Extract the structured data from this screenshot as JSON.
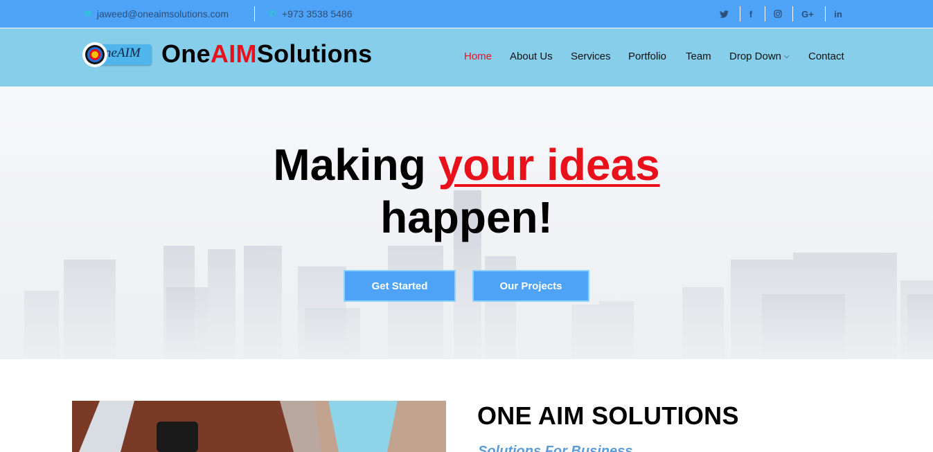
{
  "topbar": {
    "email": "jaweed@oneaimsolutions.com",
    "email_icon": "envelope-icon",
    "phone": "+973 3538 5486",
    "phone_icon": "phone-icon",
    "social": [
      {
        "name": "twitter-icon",
        "glyph": "🐦"
      },
      {
        "name": "facebook-icon",
        "glyph": "f"
      },
      {
        "name": "instagram-icon",
        "glyph": "◎"
      },
      {
        "name": "google-plus-icon",
        "glyph": "G+"
      },
      {
        "name": "linkedin-icon",
        "glyph": "in"
      }
    ]
  },
  "header": {
    "logo_text": "neAIM",
    "brand_part1": "One",
    "brand_part2": "AIM",
    "brand_part3": "Solutions",
    "nav": [
      {
        "label": "Home",
        "active": true
      },
      {
        "label": "About Us"
      },
      {
        "label": "Services"
      },
      {
        "label": "Portfolio"
      },
      {
        "label": "Team"
      },
      {
        "label": "Drop Down",
        "dropdown": true
      },
      {
        "label": "Contact"
      }
    ]
  },
  "hero": {
    "line1_pre": "Making ",
    "line1_highlight": "your ideas",
    "line2": "happen!",
    "button_primary": "Get Started",
    "button_secondary": "Our Projects"
  },
  "about": {
    "title": "ONE AIM SOLUTIONS",
    "subtitle": "Solutions For Business"
  },
  "colors": {
    "topbar": "#4fa3f7",
    "header": "#87ceeb",
    "accent_red": "#e8101b",
    "button": "#4fa3f7"
  }
}
